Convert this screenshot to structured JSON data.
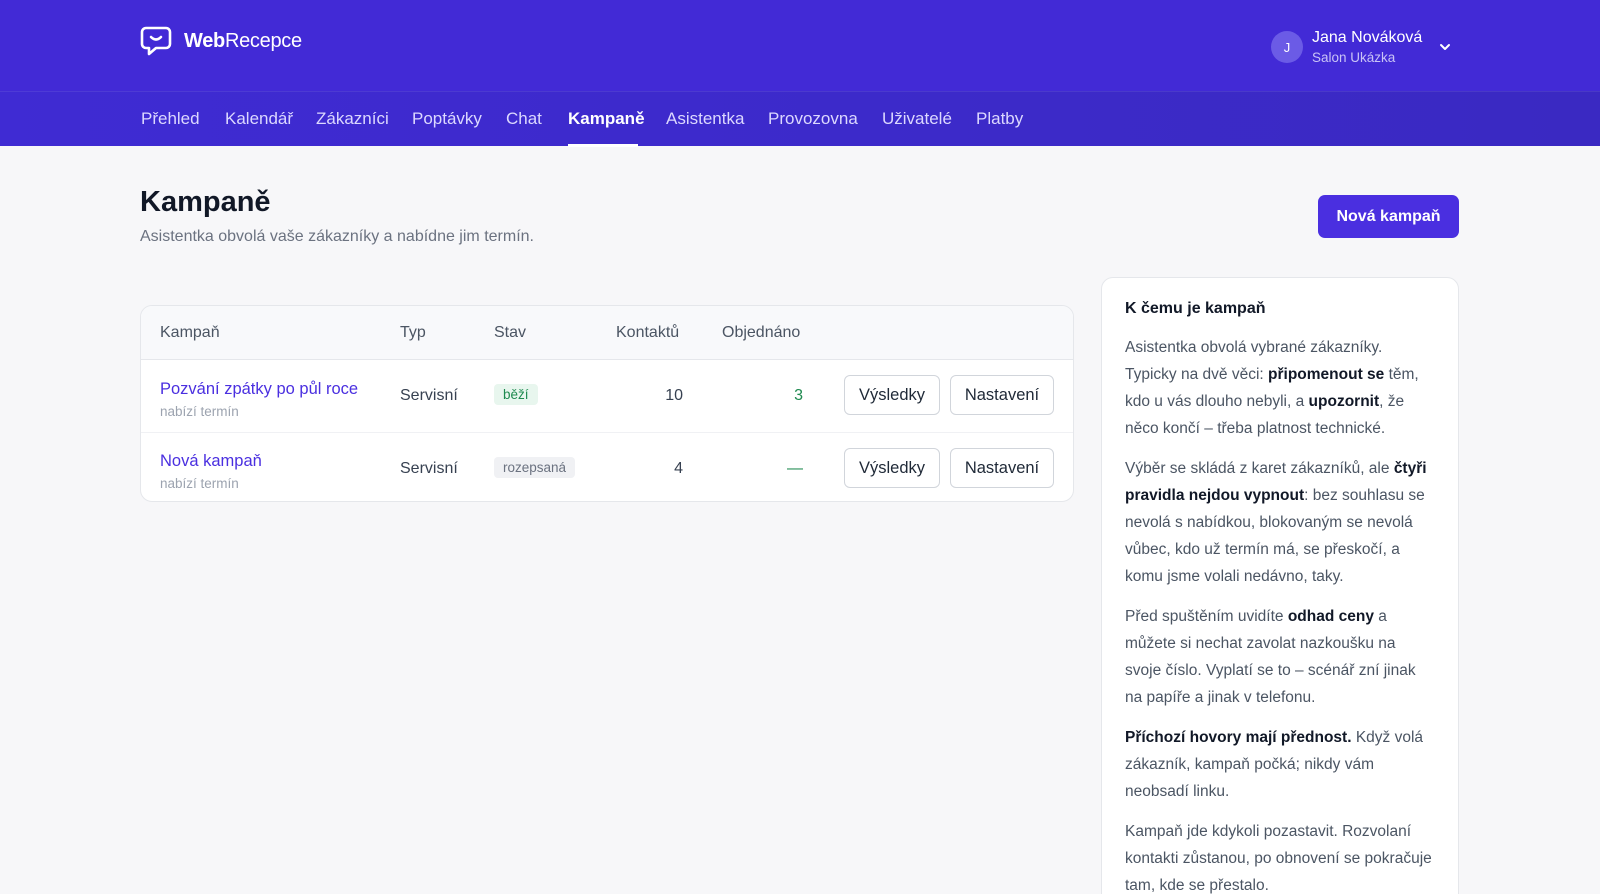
{
  "header": {
    "brand": {
      "bold": "Web",
      "regular": "Recepce",
      "icon": "chat-bubble-icon"
    },
    "user": {
      "initial": "J",
      "name": "Jana Nováková",
      "salon": "Salon Ukázka",
      "menu_icon": "chevron-down-icon"
    }
  },
  "nav": {
    "items": [
      {
        "label": "Přehled"
      },
      {
        "label": "Kalendář"
      },
      {
        "label": "Zákazníci"
      },
      {
        "label": "Poptávky"
      },
      {
        "label": "Chat"
      },
      {
        "label": "Kampaně",
        "active": true
      },
      {
        "label": "Asistentka"
      },
      {
        "label": "Provozovna"
      },
      {
        "label": "Uživatelé"
      },
      {
        "label": "Platby"
      }
    ]
  },
  "page": {
    "title": "Kampaně",
    "subtitle": "Asistentka obvolá vaše zákazníky a nabídne jim termín.",
    "new_button": "Nová kampaň"
  },
  "table": {
    "headers": {
      "campaign": "Kampaň",
      "type": "Typ",
      "status": "Stav",
      "contacts": "Kontaktů",
      "ordered": "Objednáno"
    },
    "rows": [
      {
        "name": "Pozvání zpátky po půl roce",
        "sub": "nabízí termín",
        "type": "Servisní",
        "status": "běží",
        "contacts": "10",
        "ordered": "3",
        "results_btn": "Výsledky",
        "settings_btn": "Nastavení"
      },
      {
        "name": "Nová kampaň",
        "sub": "nabízí termín",
        "type": "Servisní",
        "status": "rozepsaná",
        "contacts": "4",
        "ordered": "—",
        "results_btn": "Výsledky",
        "settings_btn": "Nastavení"
      }
    ]
  },
  "sidebar": {
    "title": "K čemu je kampaň",
    "p1": {
      "a": "Asistentka obvolá vybrané zákazníky. Typicky na dvě věci: ",
      "b1": "připomenout se",
      "c": " těm, kdo u vás dlouho nebyli, a ",
      "b2": "upozornit",
      "d": ", že něco končí – třeba platnost technické."
    },
    "p2": {
      "a": "Výběr se skládá z karet zákazníků, ale ",
      "b1": "čtyři pravidla nejdou vypnout",
      "c": ": bez souhlasu se nevolá s nabídkou, blokovaným se nevolá vůbec, kdo už termín má, se přeskočí, a komu jsme volali nedávno, taky."
    },
    "p3": {
      "a": "Před spuštěním uvidíte ",
      "b1": "odhad ceny",
      "c": " a můžete si nechat zavolat nazkoušku na svoje číslo. Vyplatí se to – scénář zní jinak na papíře a jinak v telefonu."
    },
    "p4": {
      "b1": "Příchozí hovory mají přednost.",
      "a": " Když volá zákazník, kampaň počká; nikdy vám neobsadí linku."
    },
    "p5": {
      "a": "Kampaň jde kdykoli pozastavit. Rozvolaní kontakti zůstanou, po obnovení se pokračuje tam, kde se přestalo."
    }
  }
}
